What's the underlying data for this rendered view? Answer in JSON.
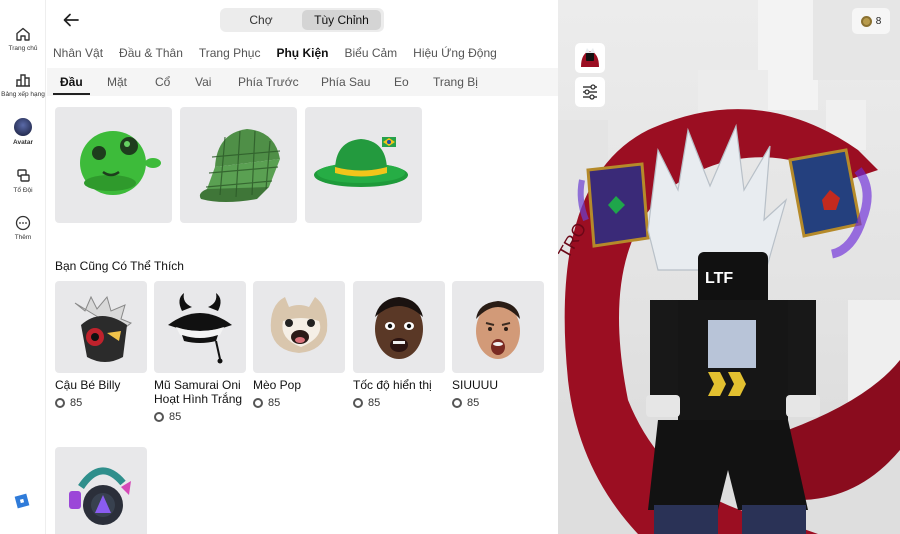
{
  "nav": {
    "items": [
      {
        "label": "Trang chủ",
        "icon": "home-icon"
      },
      {
        "label": "Bảng xếp hạng",
        "icon": "leaderboard-icon"
      },
      {
        "label": "Avatar",
        "icon": "avatar-icon"
      },
      {
        "label": "Tổ Đội",
        "icon": "party-icon"
      },
      {
        "label": "Thêm",
        "icon": "more-icon"
      }
    ],
    "logo": "roblox-logo-icon"
  },
  "header": {
    "back_icon": "arrow-left-icon",
    "segments": [
      "Chợ",
      "Tùy Chỉnh"
    ],
    "selected_segment": "Tùy Chỉnh"
  },
  "categories": [
    "Nhân Vật",
    "Đầu & Thân",
    "Trang Phục",
    "Phụ Kiện",
    "Biểu Cảm",
    "Hiệu Ứng Động"
  ],
  "selected_category": "Phụ Kiện",
  "subtabs": [
    "Đầu",
    "Mặt",
    "Cổ",
    "Vai",
    "Phía Trước",
    "Phía Sau",
    "Eo",
    "Trang Bị"
  ],
  "selected_subtab": "Đầu",
  "owned_items": [
    {
      "icon": "green-slime-hat-icon"
    },
    {
      "icon": "green-plaid-cap-icon"
    },
    {
      "icon": "green-fedora-brazil-icon"
    }
  ],
  "recommend": {
    "title": "Bạn Cũng Có Thể Thích",
    "items": [
      {
        "name": "Cậu Bé Billy",
        "price": "85",
        "icon": "billy-mask-icon"
      },
      {
        "name": "Mũ Samurai Oni Hoạt Hình Trắng",
        "price": "85",
        "icon": "samurai-hat-icon"
      },
      {
        "name": "Mèo Pop",
        "price": "85",
        "icon": "pop-cat-icon"
      },
      {
        "name": "Tốc độ hiển thị",
        "price": "85",
        "icon": "face-head-icon"
      },
      {
        "name": "SIUUUU",
        "price": "85",
        "icon": "siuuu-head-icon"
      },
      {
        "name": "",
        "price": "",
        "icon": "cyber-headphones-icon"
      }
    ]
  },
  "preview": {
    "robux": "8",
    "robux_icon": "robux-icon",
    "avatar_button_icon": "avatar-thumbnail-icon",
    "settings_icon": "sliders-icon",
    "mask_text": "LTF"
  },
  "colors": {
    "accent": "#d4d4d4",
    "coin": "#555555",
    "cape": "#9b0e22"
  }
}
